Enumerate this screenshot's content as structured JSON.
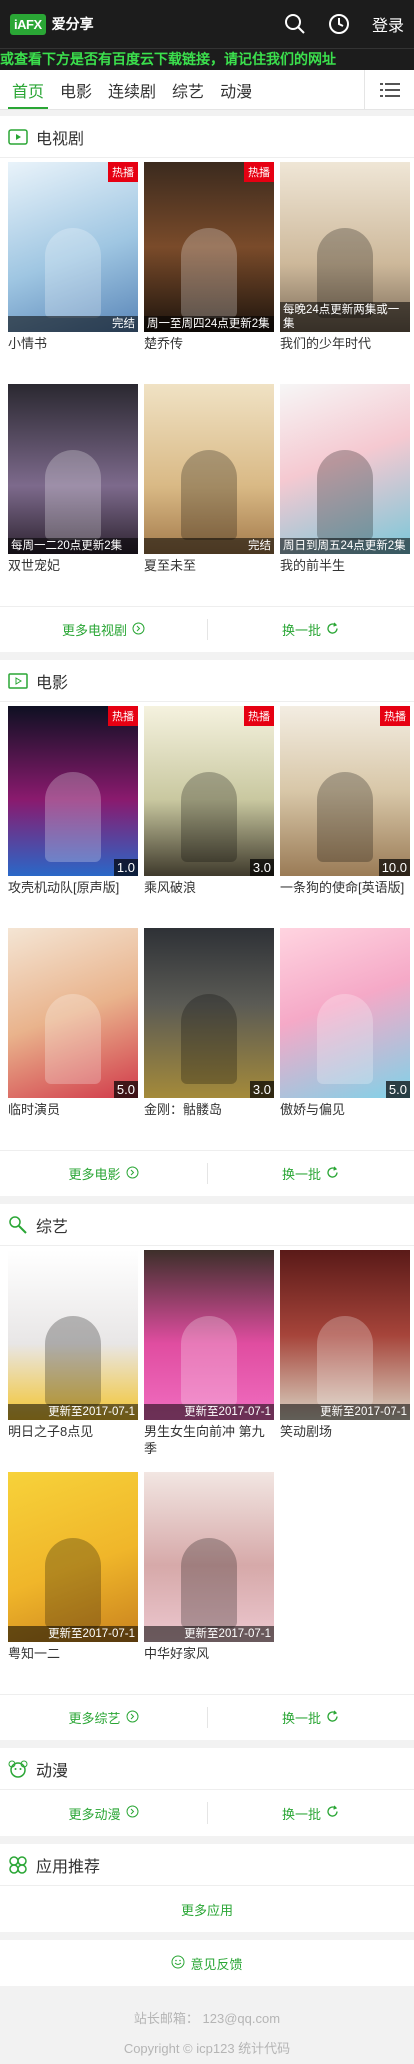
{
  "header": {
    "logo_badge": "iAFX",
    "logo_text": "爱分享",
    "login": "登录"
  },
  "marquee": "或查看下方是否有百度云下载链接，请记住我们的网址",
  "nav": {
    "items": [
      "首页",
      "电影",
      "连续剧",
      "综艺",
      "动漫"
    ],
    "active_index": 0
  },
  "sections": {
    "tv": {
      "title": "电视剧",
      "more": "更多电视剧",
      "refresh": "换一批",
      "items": [
        {
          "name": "小情书",
          "badge": "热播",
          "status": "完结"
        },
        {
          "name": "楚乔传",
          "badge": "热播",
          "status": "周一至周四24点更新2集"
        },
        {
          "name": "我们的少年时代",
          "status": "每晚24点更新两集或一集"
        },
        {
          "name": "双世宠妃",
          "status": "每周一二20点更新2集"
        },
        {
          "name": "夏至未至",
          "status": "完结"
        },
        {
          "name": "我的前半生",
          "status": "周日到周五24点更新2集"
        }
      ]
    },
    "movie": {
      "title": "电影",
      "more": "更多电影",
      "refresh": "换一批",
      "items": [
        {
          "name": "攻壳机动队[原声版]",
          "badge": "热播",
          "score": "1.0"
        },
        {
          "name": "乘风破浪",
          "badge": "热播",
          "score": "3.0"
        },
        {
          "name": "一条狗的使命[英语版]",
          "badge": "热播",
          "score": "10.0"
        },
        {
          "name": "临时演员",
          "score": "5.0"
        },
        {
          "name": "金刚：骷髅岛",
          "score": "3.0"
        },
        {
          "name": "傲娇与偏见",
          "score": "5.0"
        }
      ]
    },
    "variety": {
      "title": "综艺",
      "more": "更多综艺",
      "refresh": "换一批",
      "items": [
        {
          "name": "明日之子8点见",
          "status": "更新至2017-07-1"
        },
        {
          "name": "男生女生向前冲 第九季",
          "status": "更新至2017-07-1"
        },
        {
          "name": "笑动剧场",
          "status": "更新至2017-07-1"
        },
        {
          "name": "粤知一二",
          "status": "更新至2017-07-1"
        },
        {
          "name": "中华好家风",
          "status": "更新至2017-07-1"
        }
      ]
    },
    "anime": {
      "title": "动漫",
      "more": "更多动漫",
      "refresh": "换一批"
    },
    "apps": {
      "title": "应用推荐",
      "more": "更多应用"
    }
  },
  "feedback": "意见反馈",
  "footer": {
    "email": "站长邮箱： 123@qq.com",
    "copyright": "Copyright © icp123 统计代码"
  },
  "colors": {
    "accent": "#2aa635",
    "header_bg": "#1c1c1c",
    "marquee_text": "#3be04d",
    "hot_badge": "#e60012"
  }
}
